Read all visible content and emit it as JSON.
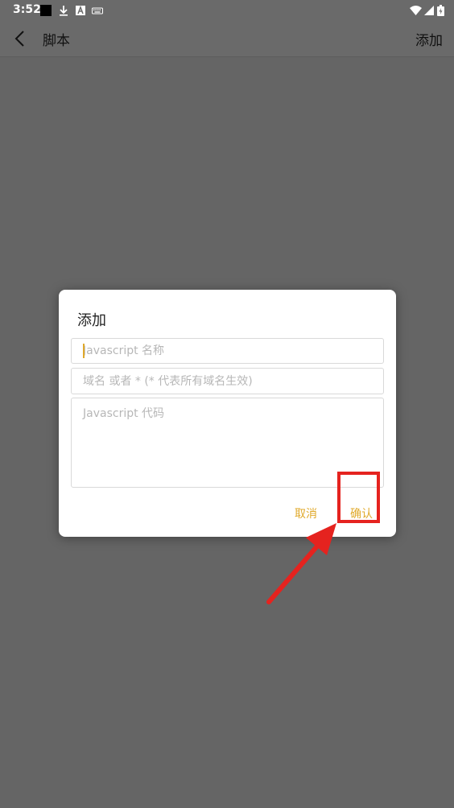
{
  "status_bar": {
    "time": "3:52",
    "icons": [
      "black-square-icon",
      "download-icon",
      "a-letter-icon",
      "keyboard-icon",
      "wifi-icon",
      "signal-icon",
      "battery-icon"
    ]
  },
  "app_bar": {
    "title": "脚本",
    "action_label": "添加",
    "back_icon": "chevron-left-icon"
  },
  "dialog": {
    "title": "添加",
    "name_placeholder": "Javascript 名称",
    "domain_placeholder": "域名 或者 * (* 代表所有域名生效)",
    "code_placeholder": "Javascript 代码",
    "cancel_label": "取消",
    "confirm_label": "确认"
  },
  "colors": {
    "accent": "#e0a92b",
    "annotation": "#e5231f",
    "scrim": "#656565"
  }
}
